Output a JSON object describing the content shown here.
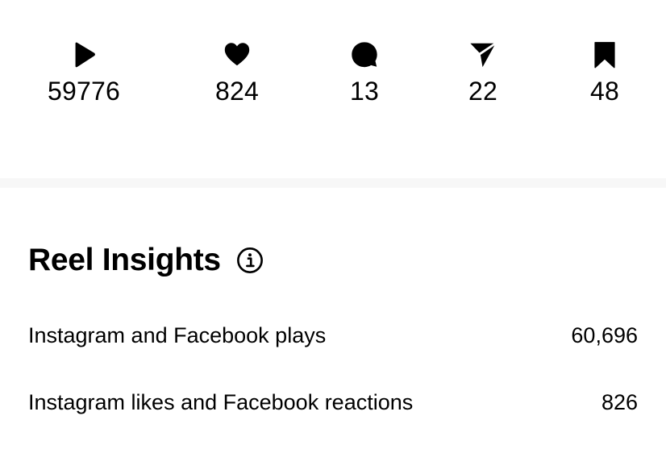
{
  "stats": [
    {
      "icon": "play-icon",
      "count": "59776"
    },
    {
      "icon": "heart-icon",
      "count": "824"
    },
    {
      "icon": "comment-icon",
      "count": "13"
    },
    {
      "icon": "share-icon",
      "count": "22"
    },
    {
      "icon": "bookmark-icon",
      "count": "48"
    }
  ],
  "insights": {
    "title": "Reel Insights",
    "info_icon": "info-icon",
    "metrics": [
      {
        "label": "Instagram and Facebook plays",
        "value": "60,696"
      },
      {
        "label": "Instagram likes and Facebook reactions",
        "value": "826"
      }
    ]
  }
}
